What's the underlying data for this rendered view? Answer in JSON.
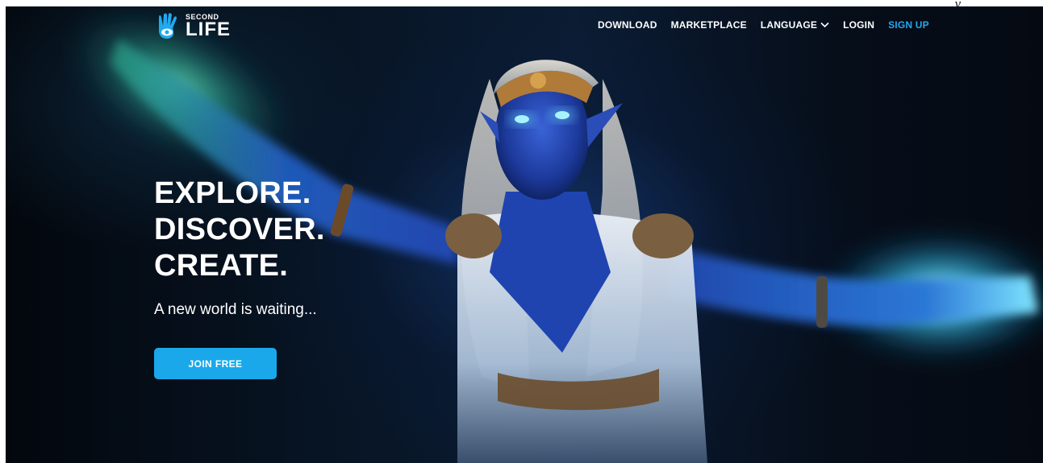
{
  "brand": {
    "name_small": "SECOND",
    "name_big": "LIFE",
    "logo_icon": "hand-eye-icon",
    "accent_color": "#1aa8ea"
  },
  "nav": {
    "download": "DOWNLOAD",
    "marketplace": "MARKETPLACE",
    "language": "LANGUAGE",
    "language_icon": "chevron-down-icon",
    "login": "LOGIN",
    "signup": "SIGN UP",
    "signup_color": "#25a7f0"
  },
  "hero": {
    "line1": "EXPLORE.",
    "line2": "DISCOVER.",
    "line3": "CREATE.",
    "tagline": "A new world is waiting...",
    "cta_label": "JOIN FREE"
  },
  "top_right_fragment": "y"
}
